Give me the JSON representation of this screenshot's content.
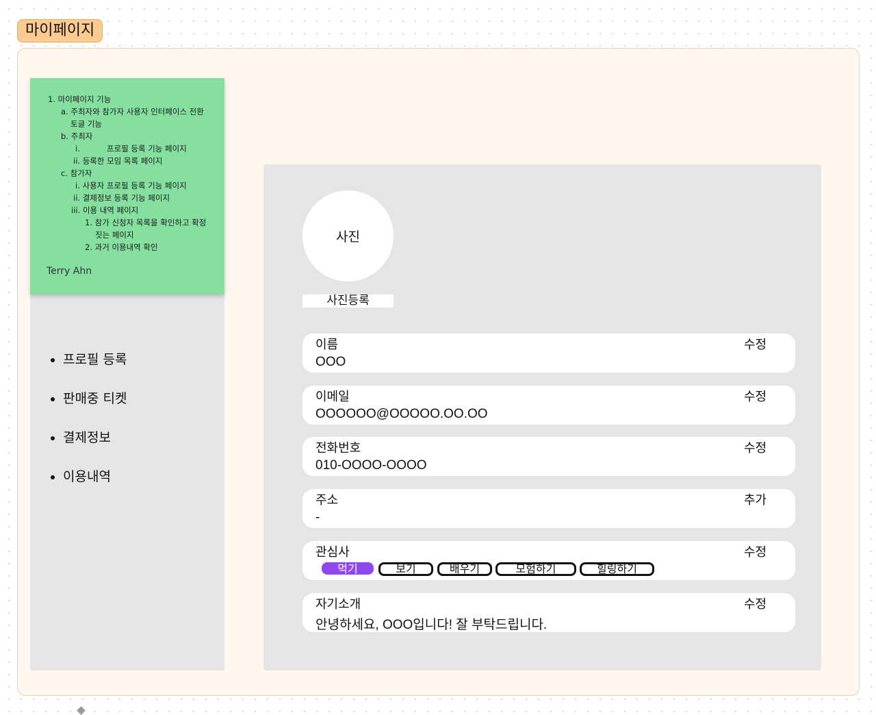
{
  "frame": {
    "title": "마이페이지"
  },
  "sticky_note": {
    "lines": [
      "1. 마이페이지 기능",
      "a. 주최자와 참가자 사용자 인터페이스 전환",
      "토글 기능",
      "b. 주최자",
      "i.",
      "프로필 등록 기능 페이지",
      "ii. 등록한 모임 목록 페이지",
      "c. 참가자",
      "i. 사용자 프로필 등록 기능 페이지",
      "ii. 결제정보 등록 기능 페이지",
      "iii. 이용 내역 페이지",
      "1. 참가 신청자 목록을 확인하고 확정",
      "짓는 페이지",
      "2. 과거 이용내역 확인"
    ],
    "author": "Terry Ahn"
  },
  "sidebar": {
    "items": [
      {
        "label": "프로필 등록"
      },
      {
        "label": "판매중 티켓"
      },
      {
        "label": "결제정보"
      },
      {
        "label": "이용내역"
      }
    ]
  },
  "profile": {
    "photo_placeholder": "사진",
    "photo_button": "사진등록",
    "fields": [
      {
        "label": "이름",
        "action": "수정",
        "value": "OOO"
      },
      {
        "label": "이메일",
        "action": "수정",
        "value": "OOOOOO@OOOOO.OO.OO"
      },
      {
        "label": "전화번호",
        "action": "수정",
        "value": "010-OOOO-OOOO"
      },
      {
        "label": "주소",
        "action": "추가",
        "value": "-"
      },
      {
        "label": "관심사",
        "action": "수정"
      },
      {
        "label": "자기소개",
        "action": "수정",
        "value": "안녕하세요, OOO입니다! 잘 부탁드립니다."
      }
    ],
    "interests": [
      {
        "label": "먹기",
        "selected": true
      },
      {
        "label": "보기",
        "selected": false
      },
      {
        "label": "배우기",
        "selected": false
      },
      {
        "label": "모험하기",
        "selected": false
      },
      {
        "label": "힐링하기",
        "selected": false
      }
    ]
  },
  "colors": {
    "frame_tag": "#fdcb8f",
    "frame_bg": "#fff7f0",
    "sticky": "#85e0a0",
    "panel": "#e5e5e5",
    "interest_selected": "#8f47ef"
  }
}
